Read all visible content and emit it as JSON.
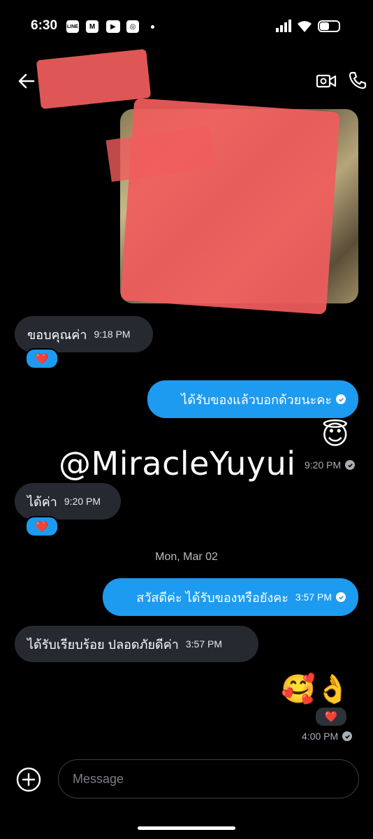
{
  "status_bar": {
    "time": "6:30",
    "app_icons": [
      "LINE",
      "M",
      "▶",
      "◎"
    ]
  },
  "header": {
    "back_icon": "arrow-left-icon",
    "video_icon": "video-call-icon",
    "phone_icon": "phone-icon"
  },
  "colors": {
    "outgoing_bubble": "#1d9bf0",
    "incoming_bubble": "#262a30",
    "background": "#000000"
  },
  "messages": [
    {
      "id": "m1",
      "direction": "incoming",
      "text": "ขอบคุณค่า",
      "time": "9:18 PM",
      "reaction": "❤️"
    },
    {
      "id": "m2",
      "direction": "outgoing",
      "text": "ได้รับของแล้วบอกด้วยนะคะ",
      "time": ""
    },
    {
      "id": "m3",
      "direction": "outgoing",
      "emoji": "😇",
      "time": "9:20 PM"
    },
    {
      "id": "m4",
      "direction": "incoming",
      "text": "ได้ค่า",
      "time": "9:20 PM",
      "reaction": "❤️"
    },
    {
      "id": "m5",
      "direction": "outgoing",
      "text": "สวัสดีค่ะ ได้รับของหรือยังคะ",
      "time": "3:57 PM"
    },
    {
      "id": "m6",
      "direction": "incoming",
      "text": "ได้รับเรียบร้อย ปลอดภัยดีค่า",
      "time": "3:57 PM"
    },
    {
      "id": "m7",
      "direction": "outgoing",
      "emoji": "🥰👌",
      "time": "4:00 PM",
      "reaction": "❤️"
    }
  ],
  "date_separator": "Mon, Mar 02",
  "watermark": "@MiracleYuyui",
  "composer": {
    "placeholder": "Message"
  }
}
